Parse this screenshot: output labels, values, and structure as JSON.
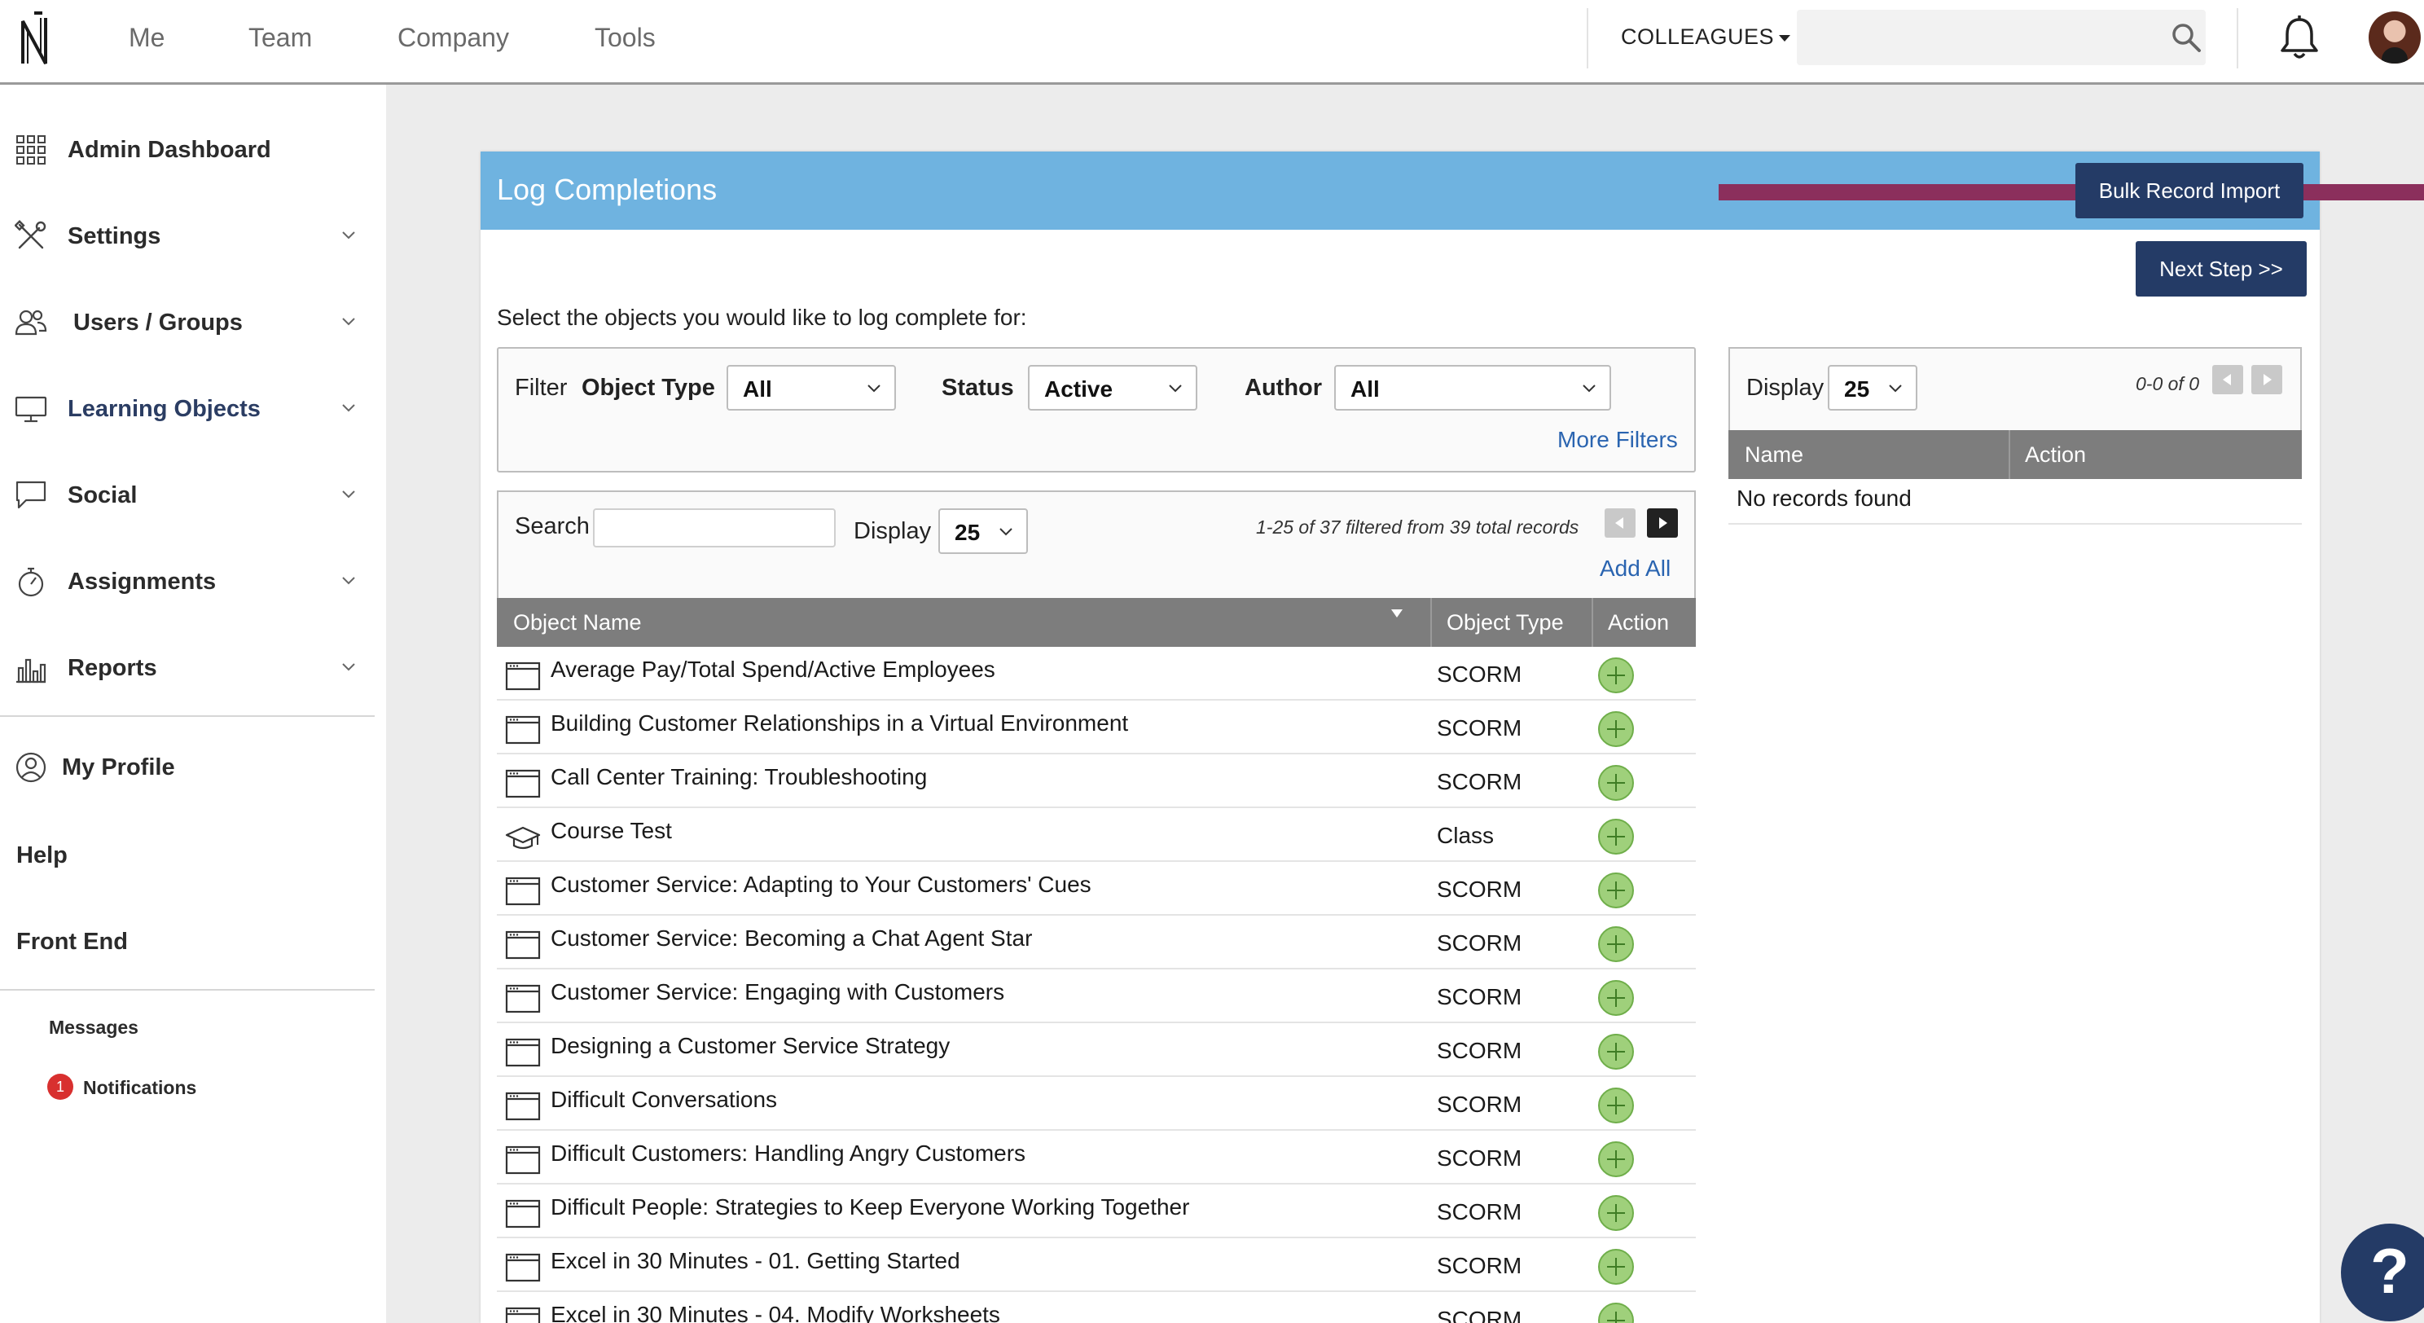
{
  "nav": {
    "logo": "N",
    "items": [
      {
        "label": "Me"
      },
      {
        "label": "Team"
      },
      {
        "label": "Company"
      },
      {
        "label": "Tools"
      }
    ],
    "colleagues_label": "COLLEAGUES",
    "search_placeholder": ""
  },
  "sidebar": {
    "items": [
      {
        "label": "Admin Dashboard",
        "icon": "grid-icon"
      },
      {
        "label": "Settings",
        "icon": "tools-icon"
      },
      {
        "label": "Users / Groups",
        "icon": "users-icon"
      },
      {
        "label": "Learning Objects",
        "icon": "monitor-icon"
      },
      {
        "label": "Social",
        "icon": "chat-icon"
      },
      {
        "label": "Assignments",
        "icon": "stopwatch-icon"
      },
      {
        "label": "Reports",
        "icon": "bar-chart-icon"
      }
    ],
    "my_profile": "My Profile",
    "help": "Help",
    "front_end": "Front End",
    "messages": "Messages",
    "notifications": "Notifications",
    "notification_count": "1"
  },
  "panel": {
    "title": "Log Completions",
    "bulk_import_label": "Bulk Record Import",
    "next_step_label": "Next Step >>",
    "instruction": "Select the objects you would like to log complete for:",
    "arrow_color": "#8b2f5c",
    "header_color": "#6fb3e0",
    "button_color": "#243b66"
  },
  "filter": {
    "filter_label": "Filter",
    "object_type_label": "Object Type",
    "object_type_value": "All",
    "status_label": "Status",
    "status_value": "Active",
    "author_label": "Author",
    "author_value": "All",
    "more_filters": "More Filters"
  },
  "list": {
    "search_label": "Search",
    "search_value": "",
    "display_label": "Display",
    "display_value": "25",
    "records_text": "1-25 of 37 filtered from 39 total records",
    "add_all": "Add All",
    "columns": [
      "Object Name",
      "Object Type",
      "Action"
    ],
    "rows": [
      {
        "name": "Average Pay/Total Spend/Active Employees",
        "type": "SCORM",
        "icon": "scorm-window-icon"
      },
      {
        "name": "Building Customer Relationships in a Virtual Environment",
        "type": "SCORM",
        "icon": "scorm-window-icon"
      },
      {
        "name": "Call Center Training: Troubleshooting",
        "type": "SCORM",
        "icon": "scorm-window-icon"
      },
      {
        "name": "Course Test",
        "type": "Class",
        "icon": "graduation-cap-icon"
      },
      {
        "name": "Customer Service: Adapting to Your Customers' Cues",
        "type": "SCORM",
        "icon": "scorm-window-icon"
      },
      {
        "name": "Customer Service: Becoming a Chat Agent Star",
        "type": "SCORM",
        "icon": "scorm-window-icon"
      },
      {
        "name": "Customer Service: Engaging with Customers",
        "type": "SCORM",
        "icon": "scorm-window-icon"
      },
      {
        "name": "Designing a Customer Service Strategy",
        "type": "SCORM",
        "icon": "scorm-window-icon"
      },
      {
        "name": "Difficult Conversations",
        "type": "SCORM",
        "icon": "scorm-window-icon"
      },
      {
        "name": "Difficult Customers: Handling Angry Customers",
        "type": "SCORM",
        "icon": "scorm-window-icon"
      },
      {
        "name": "Difficult People: Strategies to Keep Everyone Working Together",
        "type": "SCORM",
        "icon": "scorm-window-icon"
      },
      {
        "name": "Excel in 30 Minutes - 01. Getting Started",
        "type": "SCORM",
        "icon": "scorm-window-icon"
      },
      {
        "name": "Excel in 30 Minutes - 04. Modify Worksheets",
        "type": "SCORM",
        "icon": "scorm-window-icon"
      }
    ]
  },
  "selected": {
    "display_label": "Display",
    "display_value": "25",
    "records_text": "0-0 of 0",
    "columns": [
      "Name",
      "Action"
    ],
    "empty_text": "No records found"
  },
  "help_label": "?"
}
